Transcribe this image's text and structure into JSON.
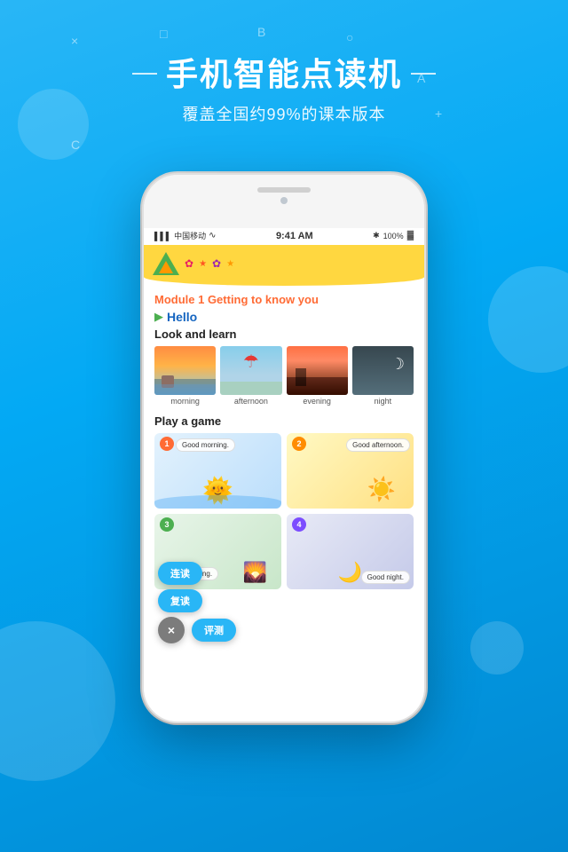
{
  "background": {
    "color": "#29b6f6"
  },
  "header": {
    "symbols": [
      "×",
      "□",
      "B",
      "○",
      "A"
    ],
    "dash": "—",
    "title": "手机智能点读机",
    "subtitle": "覆盖全国约99%的课本版本"
  },
  "phone": {
    "status_bar": {
      "carrier": "中国移动",
      "wifi": "WiFi",
      "time": "9:41 AM",
      "bluetooth": "✱",
      "battery": "100%"
    },
    "app": {
      "module_title": "Module 1   Getting to know you",
      "hello_label": "Hello",
      "section_look": "Look and learn",
      "images": [
        {
          "label": "morning"
        },
        {
          "label": "afternoon"
        },
        {
          "label": "evening"
        },
        {
          "label": "night"
        }
      ],
      "section_game": "Play a game",
      "games": [
        {
          "num": "1",
          "bubble": "Good morning."
        },
        {
          "num": "2",
          "bubble": "Good afternoon."
        },
        {
          "num": "3",
          "bubble": "Good evening."
        },
        {
          "num": "4",
          "bubble": "Good night."
        }
      ]
    }
  },
  "float_buttons": {
    "lian_du": "连读",
    "fu_du": "复读",
    "ping_ce": "评测",
    "close": "×"
  }
}
